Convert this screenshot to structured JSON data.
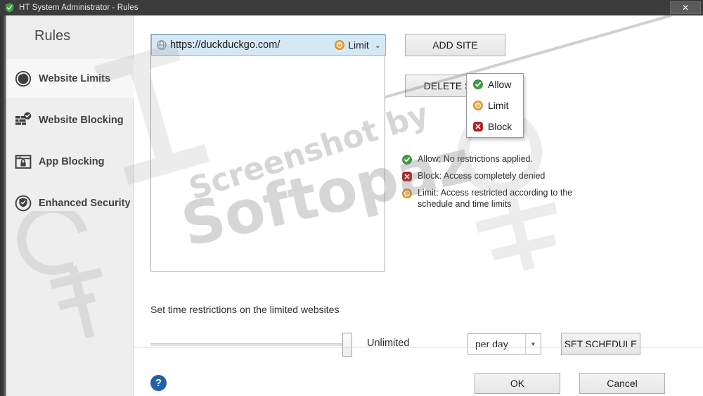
{
  "window": {
    "title": "HT System Administrator - Rules",
    "app_icon": "shield-icon",
    "close_label": "✕"
  },
  "sidebar": {
    "title": "Rules",
    "items": [
      {
        "label": "Website Limits",
        "icon": "clock-icon",
        "selected": true
      },
      {
        "label": "Website Blocking",
        "icon": "brick-wall-icon",
        "selected": false
      },
      {
        "label": "App Blocking",
        "icon": "app-lock-icon",
        "selected": false
      },
      {
        "label": "Enhanced Security",
        "icon": "shield-check-icon",
        "selected": false
      }
    ]
  },
  "site_list": {
    "rows": [
      {
        "url": "https://duckduckgo.com/",
        "favicon": "globe-icon",
        "status": "Limit",
        "status_icon": "limit-icon",
        "chevron": "⌄"
      }
    ]
  },
  "status_dropdown": {
    "open": true,
    "options": [
      {
        "label": "Allow",
        "icon": "allow-icon"
      },
      {
        "label": "Limit",
        "icon": "limit-icon"
      },
      {
        "label": "Block",
        "icon": "block-icon"
      }
    ]
  },
  "actions": {
    "add_site": "ADD SITE",
    "delete_site": "DELETE SITE",
    "set_schedule": "SET SCHEDULE",
    "ok": "OK",
    "cancel": "Cancel",
    "help": "?"
  },
  "legend": [
    {
      "icon": "allow-icon",
      "text": "Allow: No restrictions applied."
    },
    {
      "icon": "block-icon",
      "text": "Block: Access completely denied"
    },
    {
      "icon": "limit-icon",
      "text": "Limit: Access restricted according to the schedule and time limits"
    }
  ],
  "time_restrictions": {
    "label": "Set time restrictions on the limited websites",
    "slider_value_label": "Unlimited",
    "slider_percent": 97,
    "period_selected": "per day",
    "period_arrow": "▼"
  },
  "colors": {
    "allow_green": "#3fa13f",
    "block_red": "#c01a1a",
    "limit_orange": "#e8a33d",
    "selection_blue": "#d5e8f5",
    "help_blue": "#1f62a8",
    "titlebar": "#3b3b3b",
    "sidebar": "#eeeeee"
  },
  "watermark": {
    "line1": "Screenshot by",
    "line2": "Softopaz"
  }
}
